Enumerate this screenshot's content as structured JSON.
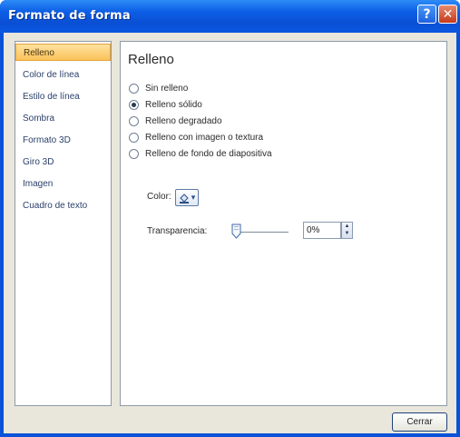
{
  "window": {
    "title": "Formato de forma",
    "help_label": "?",
    "close_label": "✕"
  },
  "sidebar": {
    "items": [
      {
        "label": "Relleno",
        "active": true
      },
      {
        "label": "Color de línea"
      },
      {
        "label": "Estilo de línea"
      },
      {
        "label": "Sombra"
      },
      {
        "label": "Formato 3D"
      },
      {
        "label": "Giro 3D"
      },
      {
        "label": "Imagen"
      },
      {
        "label": "Cuadro de texto"
      }
    ]
  },
  "panel": {
    "title": "Relleno",
    "options": [
      {
        "label": "Sin relleno",
        "checked": false
      },
      {
        "label": "Relleno sólido",
        "checked": true
      },
      {
        "label": "Relleno degradado",
        "checked": false
      },
      {
        "label": "Relleno con imagen o textura",
        "checked": false
      },
      {
        "label": "Relleno de fondo de diapositiva",
        "checked": false
      }
    ],
    "color_label": "Color:",
    "color_picker_glyph": "▾",
    "transparency_label": "Transparencia:",
    "transparency_value": "0%",
    "transparency_fraction": 0
  },
  "footer": {
    "close_button": "Cerrar"
  },
  "colors": {
    "title_bar": "#0b58e0",
    "active_nav": "#fbc25a",
    "dialog_bg": "#e9e6dc"
  }
}
